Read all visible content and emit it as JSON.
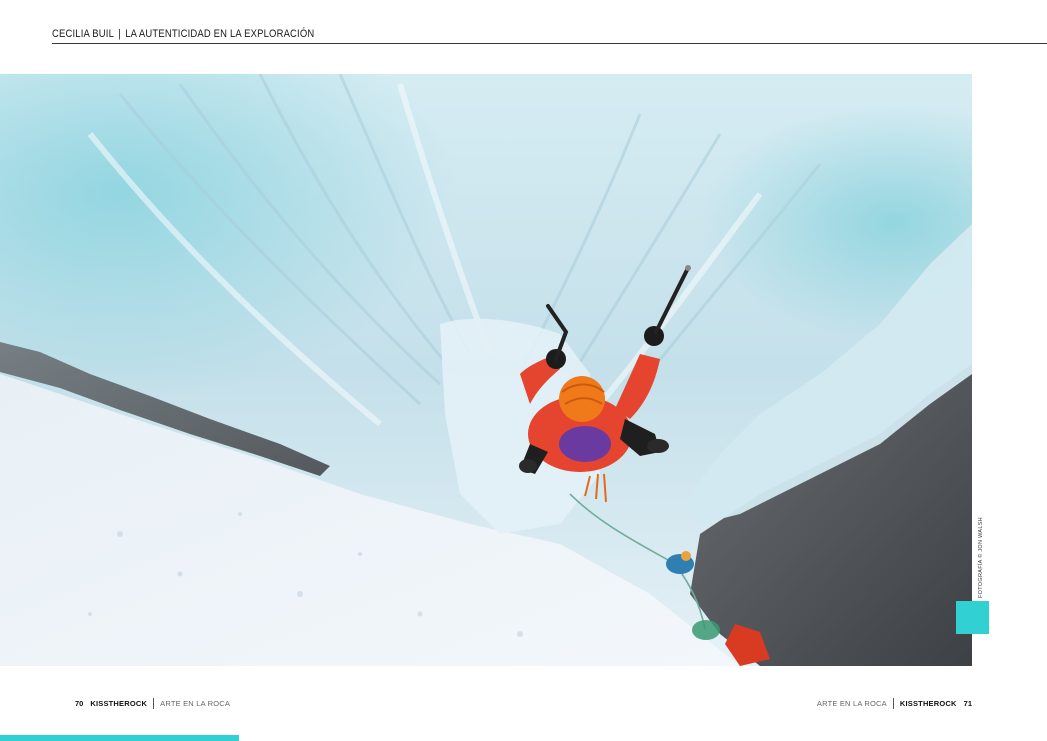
{
  "header": {
    "author": "CECILIA BUIL",
    "title": "LA AUTENTICIDAD EN LA EXPLORACIÓN"
  },
  "photo": {
    "credit": "FOTOGRAFÍA © JON WALSH"
  },
  "footer_left": {
    "page_number": "70",
    "brand": "KISSTHEROCK",
    "section": "ARTE EN LA ROCA"
  },
  "footer_right": {
    "section": "ARTE EN LA ROCA",
    "brand": "KISSTHEROCK",
    "page_number": "71"
  },
  "colors": {
    "accent": "#30d0d3",
    "ice": "#cfe6ef",
    "jacket": "#e5452f",
    "helmet": "#f07a1a"
  }
}
